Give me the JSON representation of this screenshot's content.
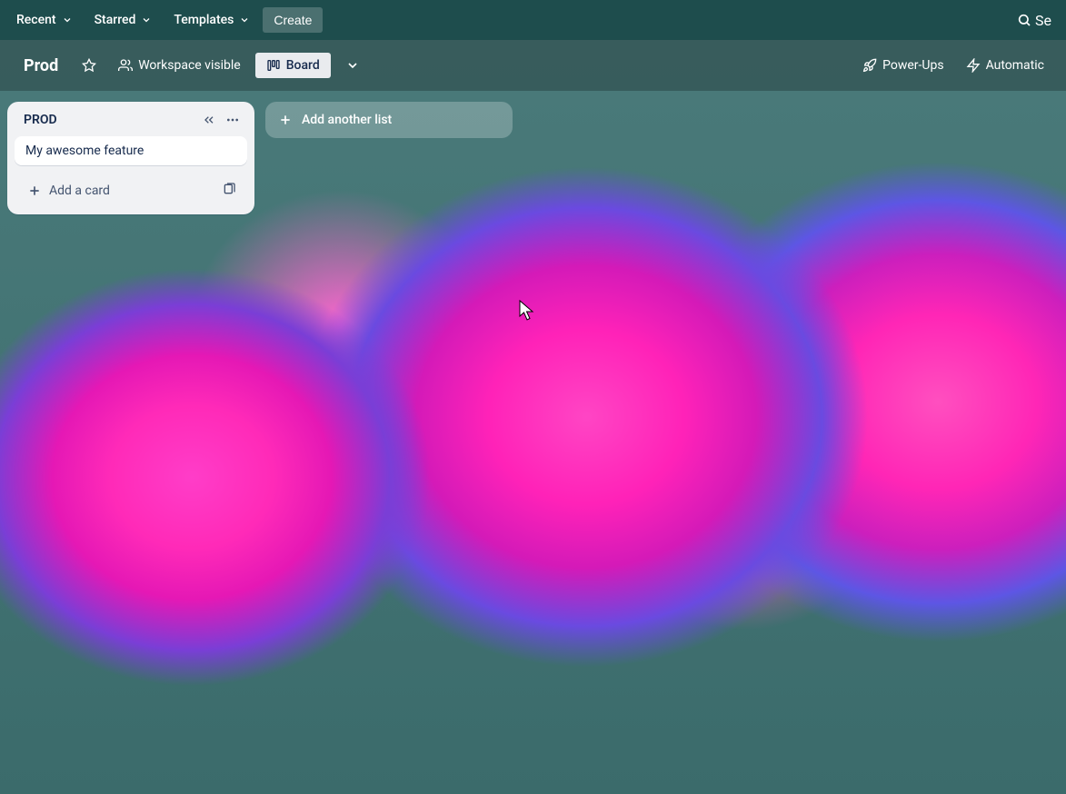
{
  "topnav": {
    "recent": "Recent",
    "starred": "Starred",
    "templates": "Templates",
    "create": "Create",
    "search_label": "Se"
  },
  "board_header": {
    "title": "Prod",
    "workspace_visible": "Workspace visible",
    "board_view": "Board",
    "power_ups": "Power-Ups",
    "automation": "Automatic"
  },
  "lists": [
    {
      "title": "PROD",
      "cards": [
        {
          "title": "My awesome feature"
        }
      ],
      "add_card_label": "Add a card"
    }
  ],
  "add_list_label": "Add another list"
}
